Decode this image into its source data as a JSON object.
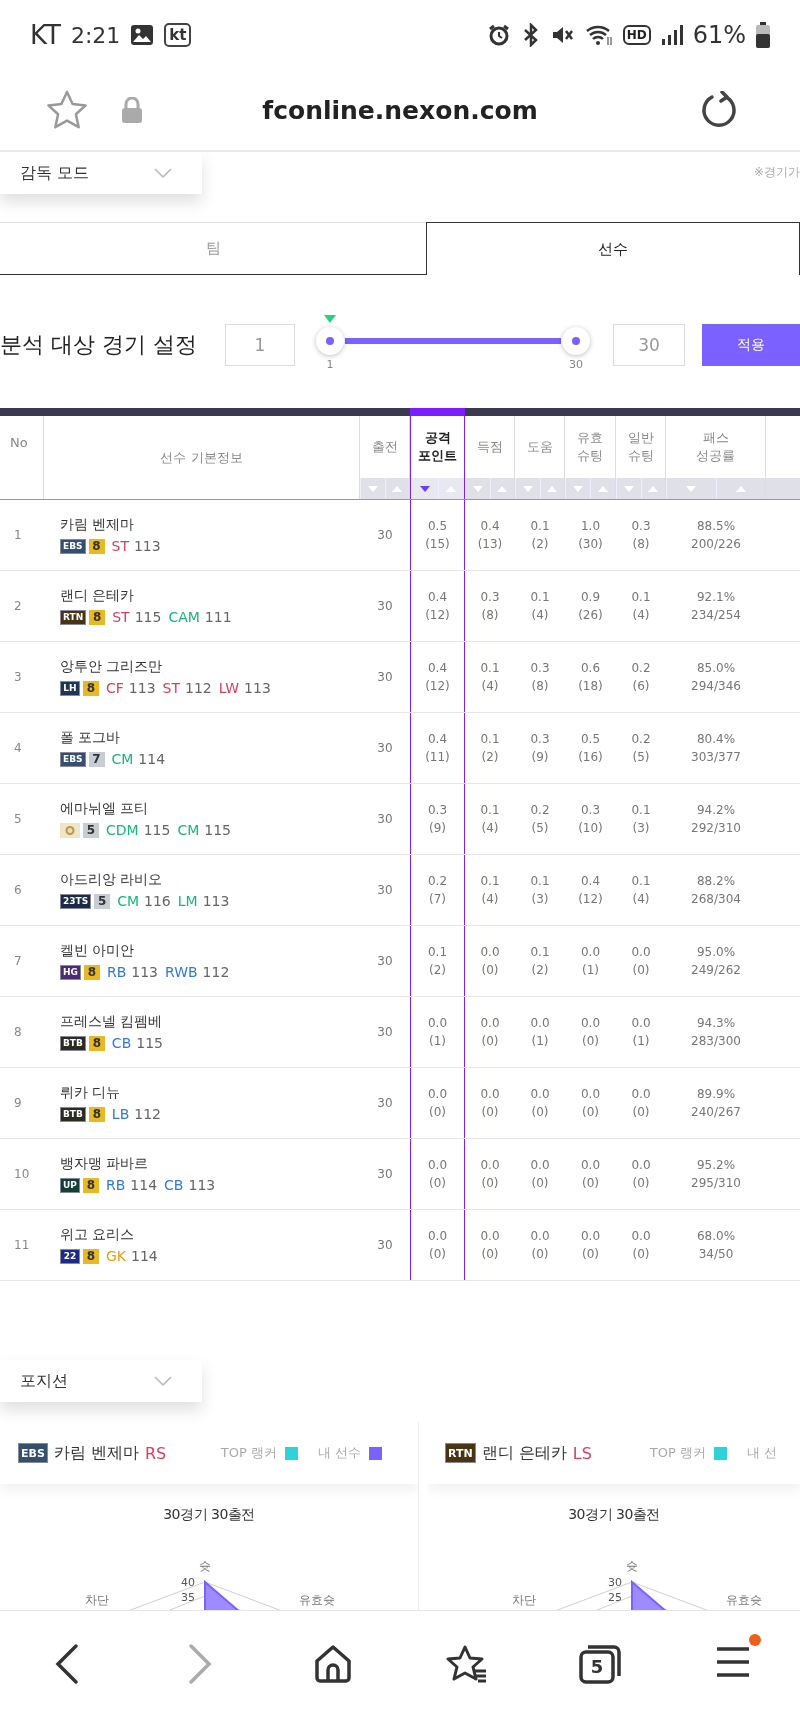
{
  "status_bar": {
    "carrier": "KT",
    "time": "2:21",
    "carrier_badge": "kt",
    "network_badge": "HD",
    "battery": "61%"
  },
  "address_bar": {
    "url": "fconline.nexon.com"
  },
  "mode_dropdown": {
    "value": "감독 모드"
  },
  "note": "※경기가",
  "tabs": [
    {
      "label": "팀",
      "selected": false
    },
    {
      "label": "선수",
      "selected": true
    }
  ],
  "range": {
    "title": "분석 대상 경기 설정",
    "from": "1",
    "to": "30",
    "min_label": "1",
    "max_label": "30",
    "level": 1,
    "button": "적용"
  },
  "table": {
    "columns": [
      {
        "label": "No",
        "sortable": false,
        "selected": false
      },
      {
        "label": "선수 기본정보",
        "sortable": false,
        "selected": false
      },
      {
        "label": "출전",
        "sortable": true,
        "selected": false
      },
      {
        "label": "공격 포인트",
        "sortable": true,
        "selected": true
      },
      {
        "label": "득점",
        "sortable": true,
        "selected": false
      },
      {
        "label": "도움",
        "sortable": true,
        "selected": false
      },
      {
        "label": "유효 슈팅",
        "sortable": true,
        "selected": false
      },
      {
        "label": "일반 슈팅",
        "sortable": true,
        "selected": false
      },
      {
        "label": "패스 성공률",
        "sortable": true,
        "selected": false
      }
    ],
    "rows": [
      {
        "no": "1",
        "name": "카림 벤제마",
        "season": {
          "label": "EBS",
          "color": "#34506e"
        },
        "grade": {
          "label": "8",
          "color": "#e8b923"
        },
        "positions": [
          {
            "label": "ST",
            "ovr": "113",
            "color": "#d6405e"
          }
        ],
        "apps": "30",
        "stats": [
          {
            "value": "0.5",
            "count": "(15)"
          },
          {
            "value": "0.4",
            "count": "(13)"
          },
          {
            "value": "0.1",
            "count": "(2)"
          },
          {
            "value": "1.0",
            "count": "(30)"
          },
          {
            "value": "0.3",
            "count": "(8)"
          },
          {
            "value": "88.5%",
            "count": "200/226"
          }
        ]
      },
      {
        "no": "2",
        "name": "랜디 은테카",
        "season": {
          "label": "RTN",
          "color": "#4a3312"
        },
        "grade": {
          "label": "8",
          "color": "#e8b923"
        },
        "positions": [
          {
            "label": "ST",
            "ovr": "115",
            "color": "#d6405e"
          },
          {
            "label": "CAM",
            "ovr": "111",
            "color": "#18b57a"
          }
        ],
        "apps": "30",
        "stats": [
          {
            "value": "0.4",
            "count": "(12)"
          },
          {
            "value": "0.3",
            "count": "(8)"
          },
          {
            "value": "0.1",
            "count": "(4)"
          },
          {
            "value": "0.9",
            "count": "(26)"
          },
          {
            "value": "0.1",
            "count": "(4)"
          },
          {
            "value": "92.1%",
            "count": "234/254"
          }
        ]
      },
      {
        "no": "3",
        "name": "앙투안 그리즈만",
        "season": {
          "label": "LH",
          "color": "#1d3557"
        },
        "grade": {
          "label": "8",
          "color": "#e8b923"
        },
        "positions": [
          {
            "label": "CF",
            "ovr": "113",
            "color": "#d6405e"
          },
          {
            "label": "ST",
            "ovr": "112",
            "color": "#d6405e"
          },
          {
            "label": "LW",
            "ovr": "113",
            "color": "#d6405e"
          }
        ],
        "apps": "30",
        "stats": [
          {
            "value": "0.4",
            "count": "(12)"
          },
          {
            "value": "0.1",
            "count": "(4)"
          },
          {
            "value": "0.3",
            "count": "(8)"
          },
          {
            "value": "0.6",
            "count": "(18)"
          },
          {
            "value": "0.2",
            "count": "(6)"
          },
          {
            "value": "85.0%",
            "count": "294/346"
          }
        ]
      },
      {
        "no": "4",
        "name": "폴 포그바",
        "season": {
          "label": "EBS",
          "color": "#34506e"
        },
        "grade": {
          "label": "7",
          "color": "#c8ccd4"
        },
        "positions": [
          {
            "label": "CM",
            "ovr": "114",
            "color": "#18b57a"
          }
        ],
        "apps": "30",
        "stats": [
          {
            "value": "0.4",
            "count": "(11)"
          },
          {
            "value": "0.1",
            "count": "(2)"
          },
          {
            "value": "0.3",
            "count": "(9)"
          },
          {
            "value": "0.5",
            "count": "(16)"
          },
          {
            "value": "0.2",
            "count": "(5)"
          },
          {
            "value": "80.4%",
            "count": "303/377"
          }
        ]
      },
      {
        "no": "5",
        "name": "에마뉘엘 프티",
        "season": {
          "color": "#efe5c8"
        },
        "grade": {
          "label": "5",
          "color": "#c8ccd4"
        },
        "positions": [
          {
            "label": "CDM",
            "ovr": "115",
            "color": "#18b57a"
          },
          {
            "label": "CM",
            "ovr": "115",
            "color": "#18b57a"
          }
        ],
        "apps": "30",
        "stats": [
          {
            "value": "0.3",
            "count": "(9)"
          },
          {
            "value": "0.1",
            "count": "(4)"
          },
          {
            "value": "0.2",
            "count": "(5)"
          },
          {
            "value": "0.3",
            "count": "(10)"
          },
          {
            "value": "0.1",
            "count": "(3)"
          },
          {
            "value": "94.2%",
            "count": "292/310"
          }
        ]
      },
      {
        "no": "6",
        "name": "아드리앙 라비오",
        "season": {
          "label": "23TS",
          "color": "#1b2a48"
        },
        "grade": {
          "label": "5",
          "color": "#c8ccd4"
        },
        "positions": [
          {
            "label": "CM",
            "ovr": "116",
            "color": "#18b57a"
          },
          {
            "label": "LM",
            "ovr": "113",
            "color": "#18b57a"
          }
        ],
        "apps": "30",
        "stats": [
          {
            "value": "0.2",
            "count": "(7)"
          },
          {
            "value": "0.1",
            "count": "(4)"
          },
          {
            "value": "0.1",
            "count": "(3)"
          },
          {
            "value": "0.4",
            "count": "(12)"
          },
          {
            "value": "0.1",
            "count": "(4)"
          },
          {
            "value": "88.2%",
            "count": "268/304"
          }
        ]
      },
      {
        "no": "7",
        "name": "켈빈 아미안",
        "season": {
          "label": "HG",
          "color": "#4b2a78"
        },
        "grade": {
          "label": "8",
          "color": "#e8b923"
        },
        "positions": [
          {
            "label": "RB",
            "ovr": "113",
            "color": "#2f7ad6"
          },
          {
            "label": "RWB",
            "ovr": "112",
            "color": "#2f7ad6"
          }
        ],
        "apps": "30",
        "stats": [
          {
            "value": "0.1",
            "count": "(2)"
          },
          {
            "value": "0.0",
            "count": "(0)"
          },
          {
            "value": "0.1",
            "count": "(2)"
          },
          {
            "value": "0.0",
            "count": "(1)"
          },
          {
            "value": "0.0",
            "count": "(0)"
          },
          {
            "value": "95.0%",
            "count": "249/262"
          }
        ]
      },
      {
        "no": "8",
        "name": "프레스넬 킴펨베",
        "season": {
          "label": "BTB",
          "color": "#2b2b22"
        },
        "grade": {
          "label": "8",
          "color": "#e8b923"
        },
        "positions": [
          {
            "label": "CB",
            "ovr": "115",
            "color": "#2f7ad6"
          }
        ],
        "apps": "30",
        "stats": [
          {
            "value": "0.0",
            "count": "(1)"
          },
          {
            "value": "0.0",
            "count": "(0)"
          },
          {
            "value": "0.0",
            "count": "(1)"
          },
          {
            "value": "0.0",
            "count": "(0)"
          },
          {
            "value": "0.0",
            "count": "(1)"
          },
          {
            "value": "94.3%",
            "count": "283/300"
          }
        ]
      },
      {
        "no": "9",
        "name": "뤼카 디뉴",
        "season": {
          "label": "BTB",
          "color": "#2b2b22"
        },
        "grade": {
          "label": "8",
          "color": "#e8b923"
        },
        "positions": [
          {
            "label": "LB",
            "ovr": "112",
            "color": "#2f7ad6"
          }
        ],
        "apps": "30",
        "stats": [
          {
            "value": "0.0",
            "count": "(0)"
          },
          {
            "value": "0.0",
            "count": "(0)"
          },
          {
            "value": "0.0",
            "count": "(0)"
          },
          {
            "value": "0.0",
            "count": "(0)"
          },
          {
            "value": "0.0",
            "count": "(0)"
          },
          {
            "value": "89.9%",
            "count": "240/267"
          }
        ]
      },
      {
        "no": "10",
        "name": "뱅자맹 파바르",
        "season": {
          "label": "UP",
          "color": "#143f36"
        },
        "grade": {
          "label": "8",
          "color": "#e8b923"
        },
        "positions": [
          {
            "label": "RB",
            "ovr": "114",
            "color": "#2f7ad6"
          },
          {
            "label": "CB",
            "ovr": "113",
            "color": "#2f7ad6"
          }
        ],
        "apps": "30",
        "stats": [
          {
            "value": "0.0",
            "count": "(0)"
          },
          {
            "value": "0.0",
            "count": "(0)"
          },
          {
            "value": "0.0",
            "count": "(0)"
          },
          {
            "value": "0.0",
            "count": "(0)"
          },
          {
            "value": "0.0",
            "count": "(0)"
          },
          {
            "value": "95.2%",
            "count": "295/310"
          }
        ]
      },
      {
        "no": "11",
        "name": "위고 요리스",
        "season": {
          "label": "22",
          "color": "#1b2a8c"
        },
        "grade": {
          "label": "8",
          "color": "#e8b923"
        },
        "positions": [
          {
            "label": "GK",
            "ovr": "114",
            "color": "#e0a010"
          }
        ],
        "apps": "30",
        "stats": [
          {
            "value": "0.0",
            "count": "(0)"
          },
          {
            "value": "0.0",
            "count": "(0)"
          },
          {
            "value": "0.0",
            "count": "(0)"
          },
          {
            "value": "0.0",
            "count": "(0)"
          },
          {
            "value": "0.0",
            "count": "(0)"
          },
          {
            "value": "68.0%",
            "count": "34/50"
          }
        ]
      }
    ]
  },
  "position_dropdown": {
    "value": "포지션"
  },
  "cards": [
    {
      "season": {
        "label": "EBS",
        "color": "#34506e"
      },
      "name": "카림 벤제마",
      "position": {
        "label": "RS",
        "color": "#d6405e"
      },
      "legend": [
        {
          "label": "TOP 랭커",
          "color": "#2ed3d9"
        },
        {
          "label": "내 선수",
          "color": "#7b61ff"
        }
      ],
      "subtitle": "30경기 30출전",
      "axes": [
        "슛",
        "차단",
        "유효슛"
      ],
      "ticks": [
        "40",
        "35"
      ]
    },
    {
      "season": {
        "label": "RTN",
        "color": "#4a3312"
      },
      "name": "랜디 은테카",
      "position": {
        "label": "LS",
        "color": "#d6405e"
      },
      "legend": [
        {
          "label": "TOP 랭커",
          "color": "#2ed3d9"
        },
        {
          "label": "내 선"
        }
      ],
      "subtitle": "30경기 30출전",
      "axes": [
        "슛",
        "차단",
        "유효슛"
      ],
      "ticks": [
        "30",
        "25"
      ]
    }
  ],
  "bottom_nav": {
    "back_disabled": false,
    "forward_disabled": true,
    "tab_count": "5",
    "menu_badge": true
  }
}
